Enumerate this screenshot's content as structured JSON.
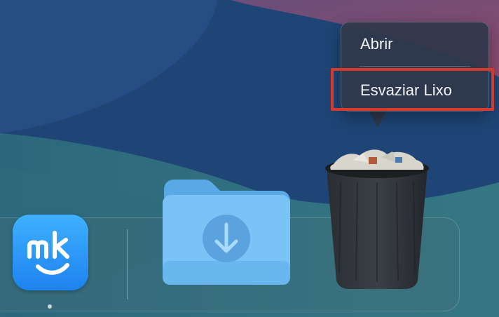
{
  "desktop": {
    "wallpaper": "macos-abstract-blue-pink"
  },
  "context_menu": {
    "items": [
      {
        "label": "Abrir"
      },
      {
        "label": "Esvaziar Lixo"
      }
    ],
    "highlighted_index": 1,
    "highlight_color": "#d63a2c"
  },
  "dock": {
    "items": [
      {
        "name": "MacKeeper",
        "icon": "mackeeper-app-icon",
        "running": true,
        "color": "#2a94f5"
      },
      {
        "name": "Downloads",
        "icon": "downloads-folder-icon",
        "color": "#6ec2f7"
      },
      {
        "name": "Trash",
        "icon": "trash-full-icon",
        "color": "#2b2f33"
      }
    ]
  }
}
